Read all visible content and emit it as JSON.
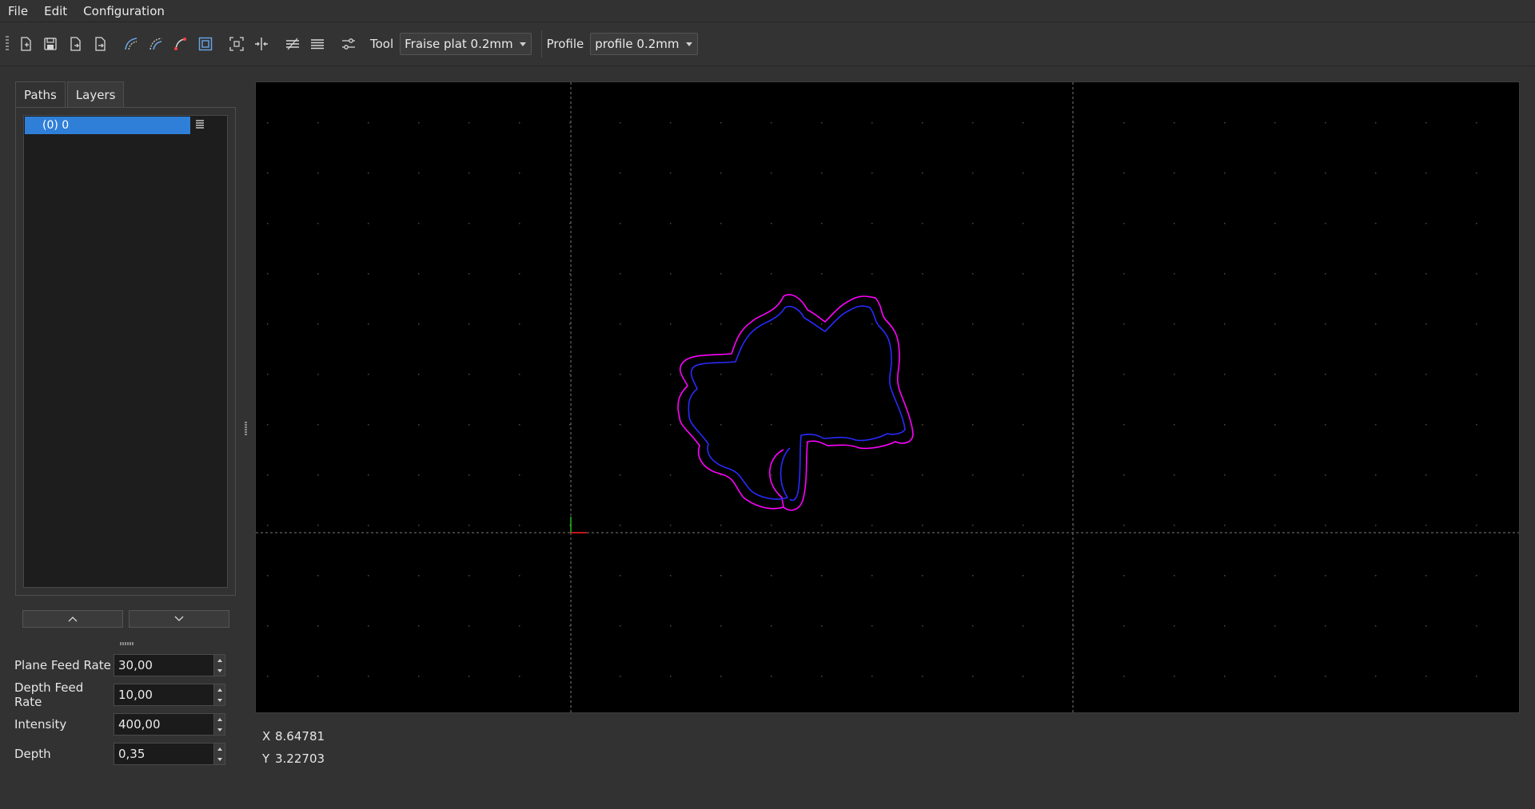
{
  "menu": {
    "items": [
      "File",
      "Edit",
      "Configuration"
    ]
  },
  "toolbar": {
    "icons": [
      "new-file-icon",
      "save-icon",
      "export-icon",
      "export-as-icon",
      "offset-path-icon",
      "inset-path-icon",
      "arc-path-icon",
      "pocket-icon",
      "zoom-fit-icon",
      "center-icon",
      "hatch-icon",
      "lines-icon",
      "settings-sliders-icon"
    ],
    "tool_label": "Tool",
    "tool_value": "Fraise plat 0.2mm",
    "profile_label": "Profile",
    "profile_value": "profile 0.2mm"
  },
  "tabs": {
    "paths": "Paths",
    "layers": "Layers"
  },
  "paths": {
    "items": [
      {
        "label": "(0) 0"
      }
    ]
  },
  "params": {
    "plane_feed_rate": {
      "label": "Plane Feed Rate",
      "value": "30,00"
    },
    "depth_feed_rate": {
      "label": "Depth Feed Rate",
      "value": "10,00"
    },
    "intensity": {
      "label": "Intensity",
      "value": "400,00"
    },
    "depth": {
      "label": "Depth",
      "value": "0,35"
    }
  },
  "status": {
    "x_label": "X",
    "x_value": "8.64781",
    "y_label": "Y",
    "y_value": "3.22703"
  },
  "colors": {
    "accent": "#2f7fd9",
    "outer_path": "#ff00ff",
    "inner_path": "#2a2aff",
    "grid_dot": "#4a4a4a",
    "axis_x": "#ff2020",
    "axis_y": "#20c020"
  }
}
